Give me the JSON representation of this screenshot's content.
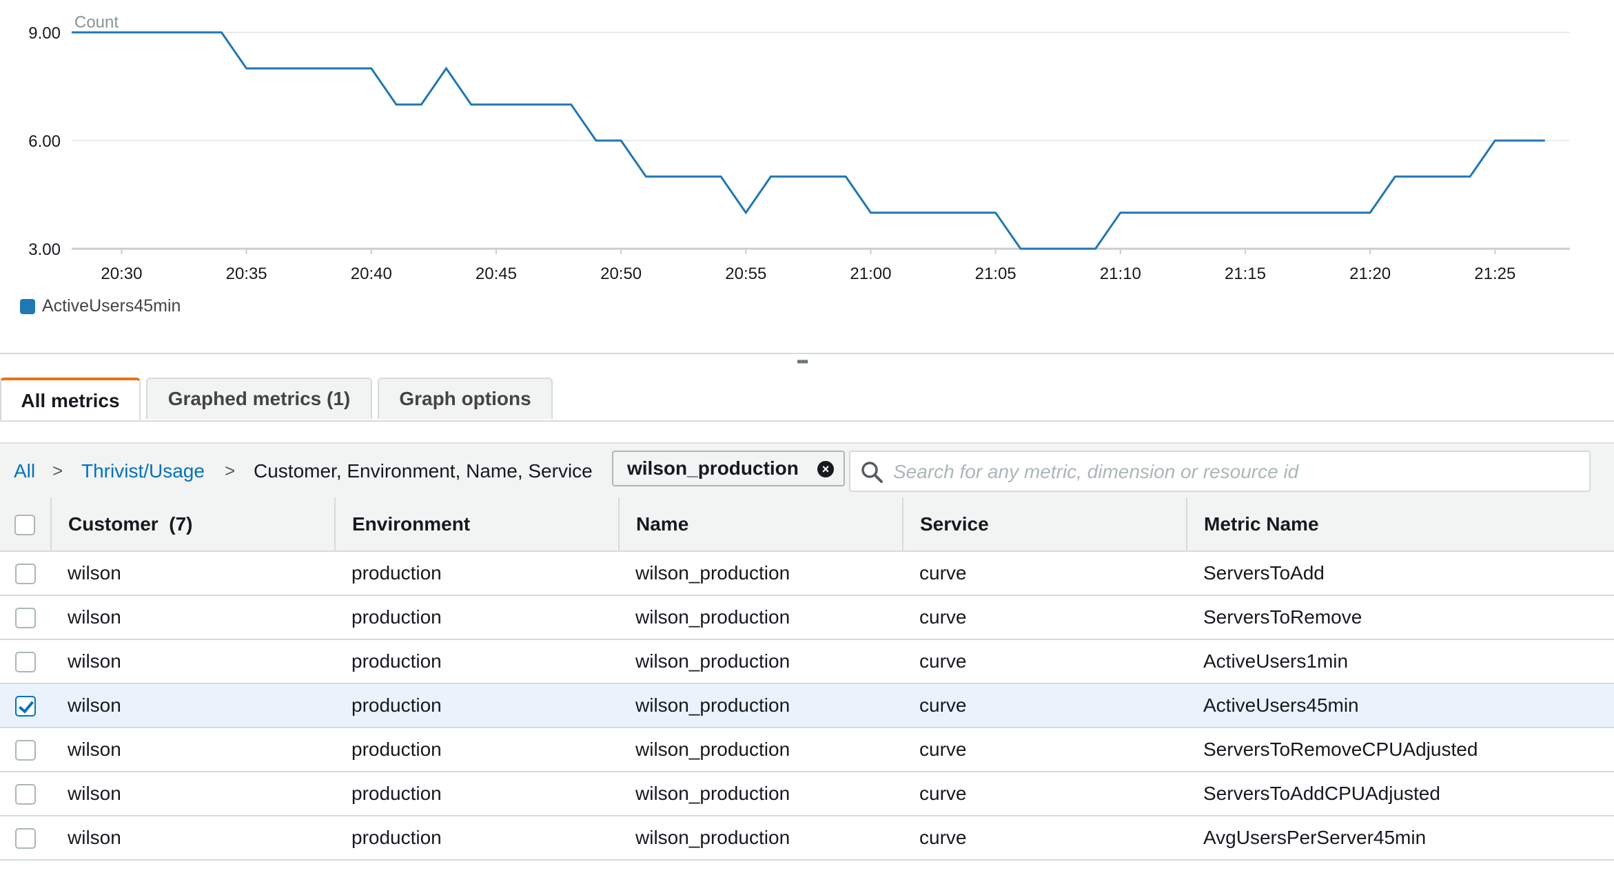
{
  "chart_data": {
    "type": "line",
    "ylabel_unit": "Count",
    "ylim": [
      3,
      9
    ],
    "yticks": [
      "9.00",
      "6.00",
      "3.00"
    ],
    "xticks": [
      "20:30",
      "20:35",
      "20:40",
      "20:45",
      "20:50",
      "20:55",
      "21:00",
      "21:05",
      "21:10",
      "21:15",
      "21:20",
      "21:25"
    ],
    "grid": true,
    "legend_position": "bottom-left",
    "series": [
      {
        "name": "ActiveUsers45min",
        "color": "#1f77b4",
        "points": [
          [
            "20:28",
            9
          ],
          [
            "20:34",
            9
          ],
          [
            "20:35",
            8
          ],
          [
            "20:40",
            8
          ],
          [
            "20:41",
            7
          ],
          [
            "20:42",
            7
          ],
          [
            "20:43",
            8
          ],
          [
            "20:44",
            7
          ],
          [
            "20:48",
            7
          ],
          [
            "20:49",
            6
          ],
          [
            "20:50",
            6
          ],
          [
            "20:51",
            5
          ],
          [
            "20:53",
            5
          ],
          [
            "20:54",
            5
          ],
          [
            "20:55",
            4
          ],
          [
            "20:56",
            5
          ],
          [
            "20:59",
            5
          ],
          [
            "21:00",
            4
          ],
          [
            "21:05",
            4
          ],
          [
            "21:06",
            3
          ],
          [
            "21:09",
            3
          ],
          [
            "21:10",
            4
          ],
          [
            "21:20",
            4
          ],
          [
            "21:21",
            5
          ],
          [
            "21:24",
            5
          ],
          [
            "21:25",
            6
          ],
          [
            "21:27",
            6
          ]
        ]
      }
    ]
  },
  "legend": {
    "label": "ActiveUsers45min"
  },
  "tabs": [
    {
      "label": "All metrics",
      "active": true
    },
    {
      "label": "Graphed metrics (1)",
      "active": false
    },
    {
      "label": "Graph options",
      "active": false
    }
  ],
  "breadcrumb": {
    "all": "All",
    "namespace": "Thrivist/Usage",
    "dimensions": "Customer, Environment, Name, Service",
    "separator": ">"
  },
  "filter_chip": {
    "label": "wilson_production"
  },
  "search": {
    "placeholder": "Search for any metric, dimension or resource id",
    "value": ""
  },
  "table": {
    "headers": {
      "customer": "Customer",
      "customer_count": "(7)",
      "environment": "Environment",
      "name": "Name",
      "service": "Service",
      "metric": "Metric Name"
    },
    "rows": [
      {
        "customer": "wilson",
        "environment": "production",
        "name": "wilson_production",
        "service": "curve",
        "metric": "ServersToAdd",
        "checked": false
      },
      {
        "customer": "wilson",
        "environment": "production",
        "name": "wilson_production",
        "service": "curve",
        "metric": "ServersToRemove",
        "checked": false
      },
      {
        "customer": "wilson",
        "environment": "production",
        "name": "wilson_production",
        "service": "curve",
        "metric": "ActiveUsers1min",
        "checked": false
      },
      {
        "customer": "wilson",
        "environment": "production",
        "name": "wilson_production",
        "service": "curve",
        "metric": "ActiveUsers45min",
        "checked": true
      },
      {
        "customer": "wilson",
        "environment": "production",
        "name": "wilson_production",
        "service": "curve",
        "metric": "ServersToRemoveCPUAdjusted",
        "checked": false
      },
      {
        "customer": "wilson",
        "environment": "production",
        "name": "wilson_production",
        "service": "curve",
        "metric": "ServersToAddCPUAdjusted",
        "checked": false
      },
      {
        "customer": "wilson",
        "environment": "production",
        "name": "wilson_production",
        "service": "curve",
        "metric": "AvgUsersPerServer45min",
        "checked": false
      }
    ]
  }
}
